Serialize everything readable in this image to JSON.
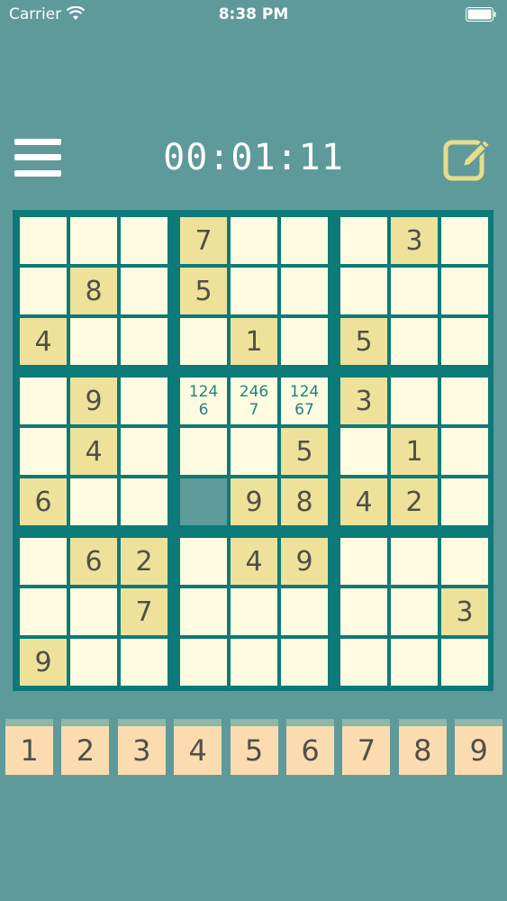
{
  "status_bar": {
    "carrier": "Carrier",
    "time": "8:38 PM"
  },
  "toolbar": {
    "timer": "00:01:11",
    "menu_icon": "hamburger-icon",
    "edit_icon": "pencil-edit-icon"
  },
  "colors": {
    "background": "#5f9a9b",
    "grid": "#0c7a78",
    "cell": "#fffbe0",
    "given_cell": "#eee29b",
    "key": "#fbdcb0"
  },
  "grid": {
    "rows": [
      [
        {
          "v": ""
        },
        {
          "v": ""
        },
        {
          "v": ""
        },
        {
          "v": "7",
          "g": true
        },
        {
          "v": ""
        },
        {
          "v": ""
        },
        {
          "v": ""
        },
        {
          "v": "3",
          "g": true
        },
        {
          "v": ""
        }
      ],
      [
        {
          "v": ""
        },
        {
          "v": "8",
          "g": true
        },
        {
          "v": ""
        },
        {
          "v": "5",
          "g": true
        },
        {
          "v": ""
        },
        {
          "v": ""
        },
        {
          "v": ""
        },
        {
          "v": ""
        },
        {
          "v": ""
        }
      ],
      [
        {
          "v": "4",
          "g": true
        },
        {
          "v": ""
        },
        {
          "v": ""
        },
        {
          "v": ""
        },
        {
          "v": "1",
          "g": true
        },
        {
          "v": ""
        },
        {
          "v": "5",
          "g": true
        },
        {
          "v": ""
        },
        {
          "v": ""
        }
      ],
      [
        {
          "v": ""
        },
        {
          "v": "9",
          "g": true
        },
        {
          "v": ""
        },
        {
          "v": "",
          "n": "124\n6"
        },
        {
          "v": "",
          "n": "246\n7"
        },
        {
          "v": "",
          "n": "124\n67"
        },
        {
          "v": "3",
          "g": true
        },
        {
          "v": ""
        },
        {
          "v": ""
        }
      ],
      [
        {
          "v": ""
        },
        {
          "v": "4",
          "g": true
        },
        {
          "v": ""
        },
        {
          "v": ""
        },
        {
          "v": ""
        },
        {
          "v": "5",
          "g": true
        },
        {
          "v": ""
        },
        {
          "v": "1",
          "g": true
        },
        {
          "v": ""
        }
      ],
      [
        {
          "v": "6",
          "g": true
        },
        {
          "v": ""
        },
        {
          "v": ""
        },
        {
          "v": "",
          "h": true
        },
        {
          "v": "9",
          "g": true
        },
        {
          "v": "8",
          "g": true
        },
        {
          "v": "4",
          "g": true
        },
        {
          "v": "2",
          "g": true
        },
        {
          "v": ""
        }
      ],
      [
        {
          "v": ""
        },
        {
          "v": "6",
          "g": true
        },
        {
          "v": "2",
          "g": true
        },
        {
          "v": ""
        },
        {
          "v": "4",
          "g": true
        },
        {
          "v": "9",
          "g": true
        },
        {
          "v": ""
        },
        {
          "v": ""
        },
        {
          "v": ""
        }
      ],
      [
        {
          "v": ""
        },
        {
          "v": ""
        },
        {
          "v": "7",
          "g": true
        },
        {
          "v": ""
        },
        {
          "v": ""
        },
        {
          "v": ""
        },
        {
          "v": ""
        },
        {
          "v": ""
        },
        {
          "v": "3",
          "g": true
        }
      ],
      [
        {
          "v": "9",
          "g": true
        },
        {
          "v": ""
        },
        {
          "v": ""
        },
        {
          "v": ""
        },
        {
          "v": ""
        },
        {
          "v": ""
        },
        {
          "v": ""
        },
        {
          "v": ""
        },
        {
          "v": ""
        }
      ]
    ]
  },
  "numpad": [
    "1",
    "2",
    "3",
    "4",
    "5",
    "6",
    "7",
    "8",
    "9"
  ]
}
